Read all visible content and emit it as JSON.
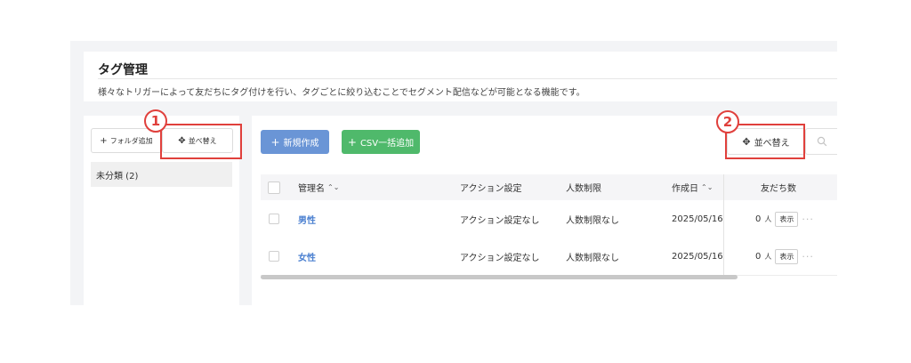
{
  "header": {
    "title": "タグ管理",
    "description": "様々なトリガーによって友だちにタグ付けを行い、タグごとに絞り込むことでセグメント配信などが可能となる機能です。"
  },
  "left_panel": {
    "add_folder_label": "フォルダ追加",
    "add_icon": "+",
    "sort_label": "並べ替え",
    "move_icon": "✥",
    "folders": [
      {
        "label": "未分類 (2)"
      }
    ]
  },
  "toolbar": {
    "new_label": "新規作成",
    "csv_label": "CSV一括追加",
    "plus_icon": "+",
    "sort_label": "並べ替え",
    "move_icon": "✥"
  },
  "table": {
    "columns": [
      "管理名",
      "アクション設定",
      "人数制限",
      "作成日",
      "友だち数"
    ],
    "sort_icon": "⌃⌄",
    "rows": [
      {
        "name": "男性",
        "action": "アクション設定なし",
        "limit": "人数制限なし",
        "created": "2025/05/16",
        "count": "0",
        "unit": "人",
        "view_label": "表示",
        "more": "···"
      },
      {
        "name": "女性",
        "action": "アクション設定なし",
        "limit": "人数制限なし",
        "created": "2025/05/16",
        "count": "0",
        "unit": "人",
        "view_label": "表示",
        "more": "···"
      }
    ]
  },
  "callouts": [
    {
      "number": "1"
    },
    {
      "number": "2"
    }
  ],
  "colors": {
    "accent_blue": "#6a95d6",
    "accent_green": "#4fb96b",
    "callout_red": "#e0403c",
    "link_blue": "#4a7fd0"
  }
}
